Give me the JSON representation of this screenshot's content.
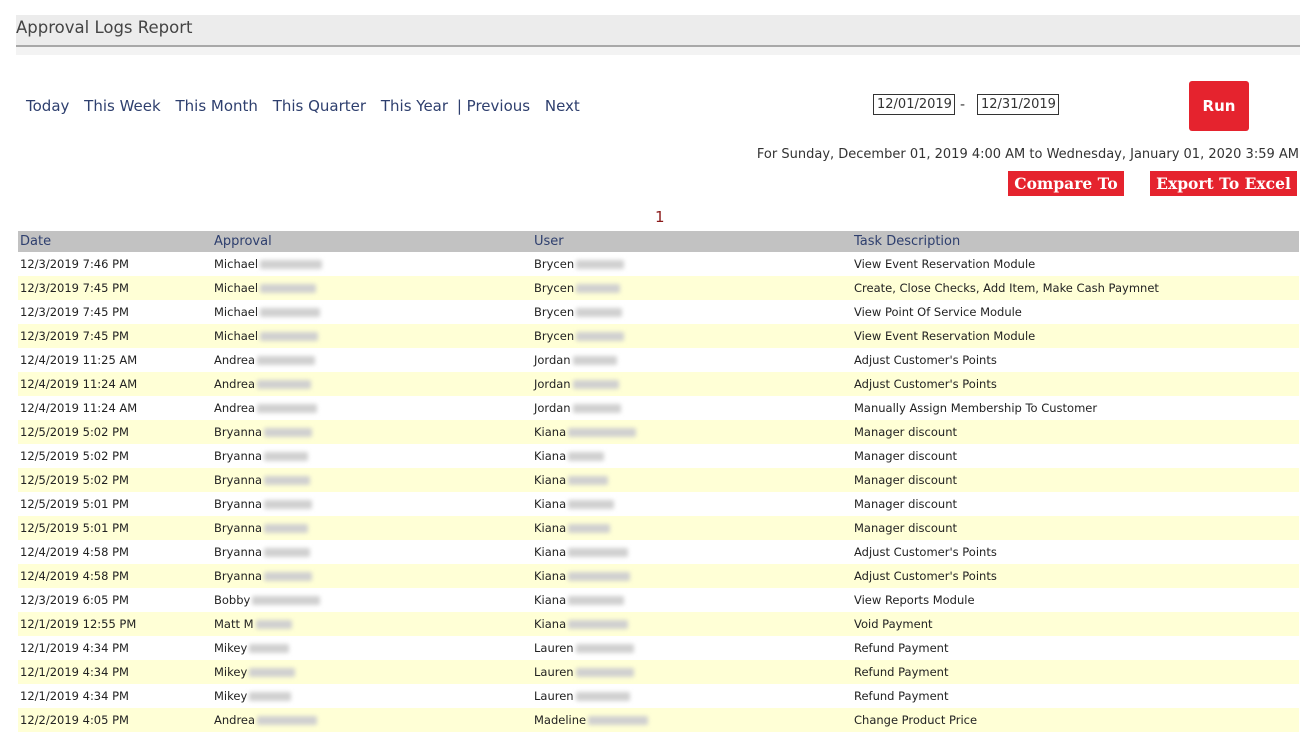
{
  "report": {
    "title": "Approval Logs Report"
  },
  "periods": [
    "Today",
    "This Week",
    "This Month",
    "This Quarter",
    "This Year"
  ],
  "nav": {
    "separator": "|",
    "previous": "Previous",
    "next": "Next"
  },
  "date_range": {
    "start": "12/01/2019",
    "separator": "-",
    "end": "12/31/2019"
  },
  "buttons": {
    "run": "Run",
    "compare": "Compare To",
    "export": "Export To Excel"
  },
  "range_text": "For Sunday, December 01, 2019 4:00 AM to Wednesday, January 01, 2020 3:59 AM",
  "pager": {
    "current": "1"
  },
  "table": {
    "columns": [
      "Date",
      "Approval",
      "User",
      "Task Description"
    ],
    "rows": [
      {
        "date": "12/3/2019 7:46 PM",
        "approval": "Michael",
        "user": "Brycen",
        "task": "View Event Reservation Module"
      },
      {
        "date": "12/3/2019 7:45 PM",
        "approval": "Michael",
        "user": "Brycen",
        "task": "Create, Close Checks, Add Item, Make Cash Paymnet"
      },
      {
        "date": "12/3/2019 7:45 PM",
        "approval": "Michael",
        "user": "Brycen",
        "task": "View Point Of Service Module"
      },
      {
        "date": "12/3/2019 7:45 PM",
        "approval": "Michael",
        "user": "Brycen",
        "task": "View Event Reservation Module"
      },
      {
        "date": "12/4/2019 11:25 AM",
        "approval": "Andrea",
        "user": "Jordan",
        "task": "Adjust Customer's Points"
      },
      {
        "date": "12/4/2019 11:24 AM",
        "approval": "Andrea",
        "user": "Jordan",
        "task": "Adjust Customer's Points"
      },
      {
        "date": "12/4/2019 11:24 AM",
        "approval": "Andrea",
        "user": "Jordan",
        "task": "Manually Assign Membership To Customer"
      },
      {
        "date": "12/5/2019 5:02 PM",
        "approval": "Bryanna",
        "user": "Kiana",
        "task": "Manager discount"
      },
      {
        "date": "12/5/2019 5:02 PM",
        "approval": "Bryanna",
        "user": "Kiana",
        "task": "Manager discount"
      },
      {
        "date": "12/5/2019 5:02 PM",
        "approval": "Bryanna",
        "user": "Kiana",
        "task": "Manager discount"
      },
      {
        "date": "12/5/2019 5:01 PM",
        "approval": "Bryanna",
        "user": "Kiana",
        "task": "Manager discount"
      },
      {
        "date": "12/5/2019 5:01 PM",
        "approval": "Bryanna",
        "user": "Kiana",
        "task": "Manager discount"
      },
      {
        "date": "12/4/2019 4:58 PM",
        "approval": "Bryanna",
        "user": "Kiana",
        "task": "Adjust Customer's Points"
      },
      {
        "date": "12/4/2019 4:58 PM",
        "approval": "Bryanna",
        "user": "Kiana",
        "task": "Adjust Customer's Points"
      },
      {
        "date": "12/3/2019 6:05 PM",
        "approval": "Bobby",
        "user": "Kiana",
        "task": "View Reports Module"
      },
      {
        "date": "12/1/2019 12:55 PM",
        "approval": "Matt M",
        "user": "Kiana",
        "task": "Void Payment"
      },
      {
        "date": "12/1/2019 4:34 PM",
        "approval": "Mikey",
        "user": "Lauren",
        "task": "Refund Payment"
      },
      {
        "date": "12/1/2019 4:34 PM",
        "approval": "Mikey",
        "user": "Lauren",
        "task": "Refund Payment"
      },
      {
        "date": "12/1/2019 4:34 PM",
        "approval": "Mikey",
        "user": "Lauren",
        "task": "Refund Payment"
      },
      {
        "date": "12/2/2019 4:05 PM",
        "approval": "Andrea",
        "user": "Madeline",
        "task": "Change Product Price"
      }
    ]
  },
  "colors": {
    "accent_red": "#e5232e",
    "link_blue": "#2e3f6e",
    "row_alt": "#ffffd6",
    "header_gray": "#c2c2c2"
  }
}
